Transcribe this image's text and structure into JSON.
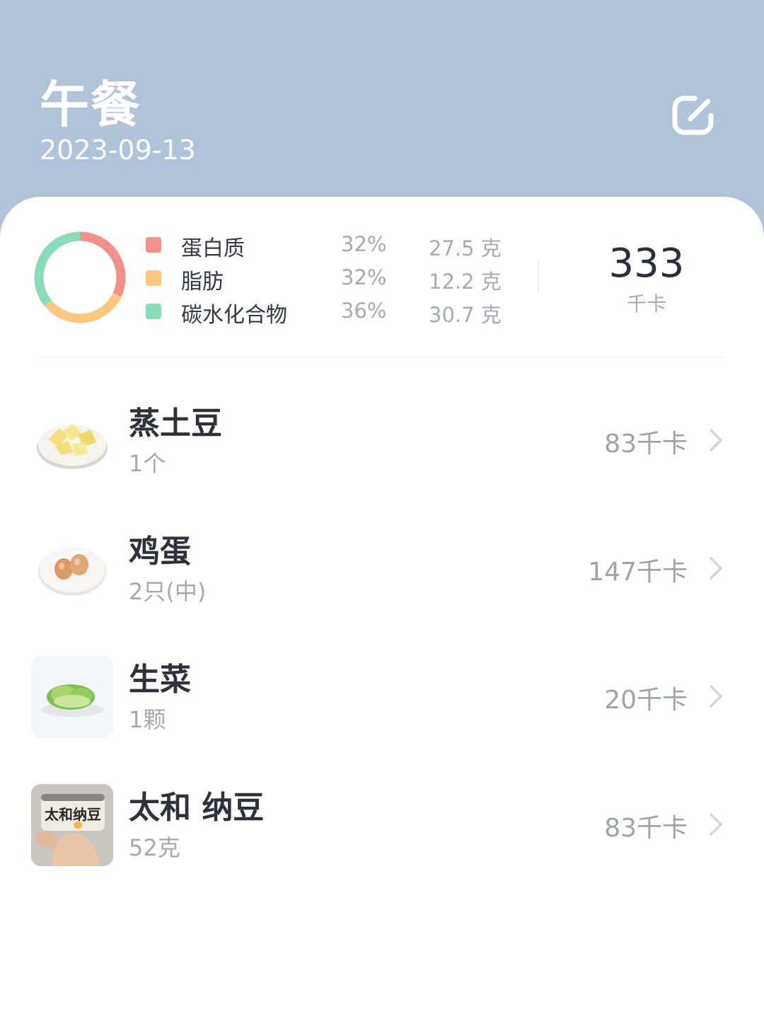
{
  "header": {
    "title": "午餐",
    "date": "2023-09-13",
    "edit_icon": "edit-icon"
  },
  "summary": {
    "macros": [
      {
        "name": "蛋白质",
        "percent": "32%",
        "amount": "27.5 克",
        "color": "#f4908a"
      },
      {
        "name": "脂肪",
        "percent": "32%",
        "amount": "12.2 克",
        "color": "#fcc87e"
      },
      {
        "name": "碳水化合物",
        "percent": "36%",
        "amount": "30.7 克",
        "color": "#87ddb9"
      }
    ],
    "total_kcal": "333",
    "kcal_unit": "千卡"
  },
  "foods": [
    {
      "name": "蒸土豆",
      "quantity": "1个",
      "kcal": "83千卡"
    },
    {
      "name": "鸡蛋",
      "quantity": "2只(中)",
      "kcal": "147千卡"
    },
    {
      "name": "生菜",
      "quantity": "1颗",
      "kcal": "20千卡"
    },
    {
      "name": "太和 纳豆",
      "quantity": "52克",
      "kcal": "83千卡",
      "package_label": "太和纳豆"
    }
  ],
  "colors": {
    "header_bg": "#b1c3d9",
    "protein": "#f4908a",
    "fat": "#fcc87e",
    "carbs": "#87ddb9"
  }
}
